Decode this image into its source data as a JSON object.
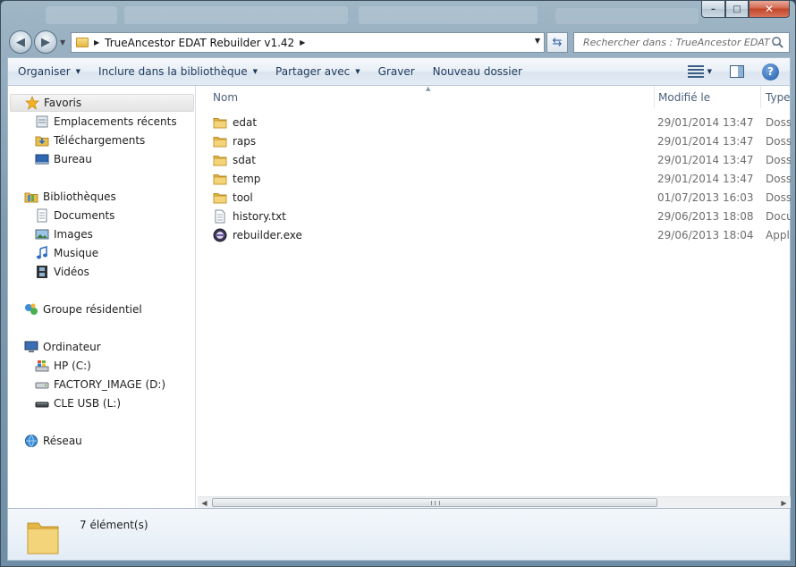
{
  "window": {
    "minimize_label": "–",
    "maximize_label": "□",
    "close_label": "✕"
  },
  "address": {
    "path_segment": "TrueAncestor EDAT Rebuilder v1.42",
    "search_placeholder": "Rechercher dans : TrueAncestor EDAT ..."
  },
  "toolbar": {
    "organize": "Organiser",
    "include_library": "Inclure dans la bibliothèque",
    "share_with": "Partager avec",
    "burn": "Graver",
    "new_folder": "Nouveau dossier"
  },
  "sidebar": {
    "favorites": {
      "label": "Favoris",
      "items": [
        "Emplacements récents",
        "Téléchargements",
        "Bureau"
      ]
    },
    "libraries": {
      "label": "Bibliothèques",
      "items": [
        "Documents",
        "Images",
        "Musique",
        "Vidéos"
      ]
    },
    "homegroup": {
      "label": "Groupe résidentiel"
    },
    "computer": {
      "label": "Ordinateur",
      "items": [
        "HP (C:)",
        "FACTORY_IMAGE (D:)",
        "CLE USB (L:)"
      ]
    },
    "network": {
      "label": "Réseau"
    }
  },
  "columns": {
    "name": "Nom",
    "modified": "Modifié le",
    "type": "Type"
  },
  "files": [
    {
      "name": "edat",
      "modified": "29/01/2014 13:47",
      "type": "Dossie",
      "icon": "folder-icon"
    },
    {
      "name": "raps",
      "modified": "29/01/2014 13:47",
      "type": "Dossie",
      "icon": "folder-icon"
    },
    {
      "name": "sdat",
      "modified": "29/01/2014 13:47",
      "type": "Dossie",
      "icon": "folder-icon"
    },
    {
      "name": "temp",
      "modified": "29/01/2014 13:47",
      "type": "Dossie",
      "icon": "folder-icon"
    },
    {
      "name": "tool",
      "modified": "01/07/2013 16:03",
      "type": "Dossie",
      "icon": "folder-icon"
    },
    {
      "name": "history.txt",
      "modified": "29/06/2013 18:08",
      "type": "Docun",
      "icon": "text-file-icon"
    },
    {
      "name": "rebuilder.exe",
      "modified": "29/06/2013 18:04",
      "type": "Applic",
      "icon": "exe-icon"
    }
  ],
  "details": {
    "item_count": "7 élément(s)"
  },
  "colors": {
    "folder": "#e5b846",
    "accent": "#1e395b",
    "frame": "#7f9bb0"
  }
}
